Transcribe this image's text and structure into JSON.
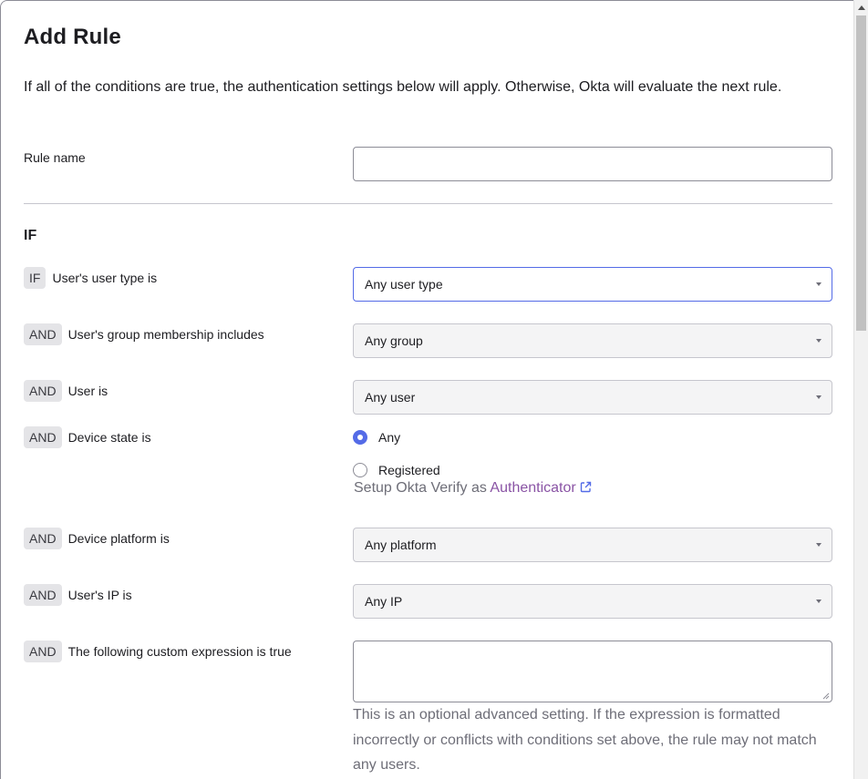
{
  "dialog": {
    "title": "Add Rule",
    "intro": "If all of the conditions are true, the authentication settings below will apply. Otherwise, Okta will evaluate the next rule."
  },
  "rule_name": {
    "label": "Rule name",
    "value": "",
    "placeholder": ""
  },
  "section": {
    "heading": "IF"
  },
  "conditions": {
    "user_type": {
      "tag": "IF",
      "label": "User's user type is",
      "value": "Any user type"
    },
    "group": {
      "tag": "AND",
      "label": "User's group membership includes",
      "value": "Any group"
    },
    "user": {
      "tag": "AND",
      "label": "User is",
      "value": "Any user"
    },
    "device_state": {
      "tag": "AND",
      "label": "Device state is",
      "options": [
        "Any",
        "Registered"
      ],
      "selected": "Any",
      "hint_prefix": "Setup Okta Verify as",
      "hint_link": "Authenticator"
    },
    "platform": {
      "tag": "AND",
      "label": "Device platform is",
      "value": "Any platform"
    },
    "ip": {
      "tag": "AND",
      "label": "User's IP is",
      "value": "Any IP"
    },
    "expression": {
      "tag": "AND",
      "label": "The following custom expression is true",
      "value": "",
      "hint": "This is an optional advanced setting. If the expression is formatted incorrectly or conflicts with conditions set above, the rule may not match any users."
    }
  },
  "colors": {
    "accent": "#546be7",
    "link": "#8a54a5",
    "tag_bg": "#e4e4e7",
    "select_bg": "#f4f4f5"
  },
  "icons": {
    "external_link": "external-link-icon",
    "caret": "caret-down-icon",
    "resize": "resize-grip-icon"
  }
}
